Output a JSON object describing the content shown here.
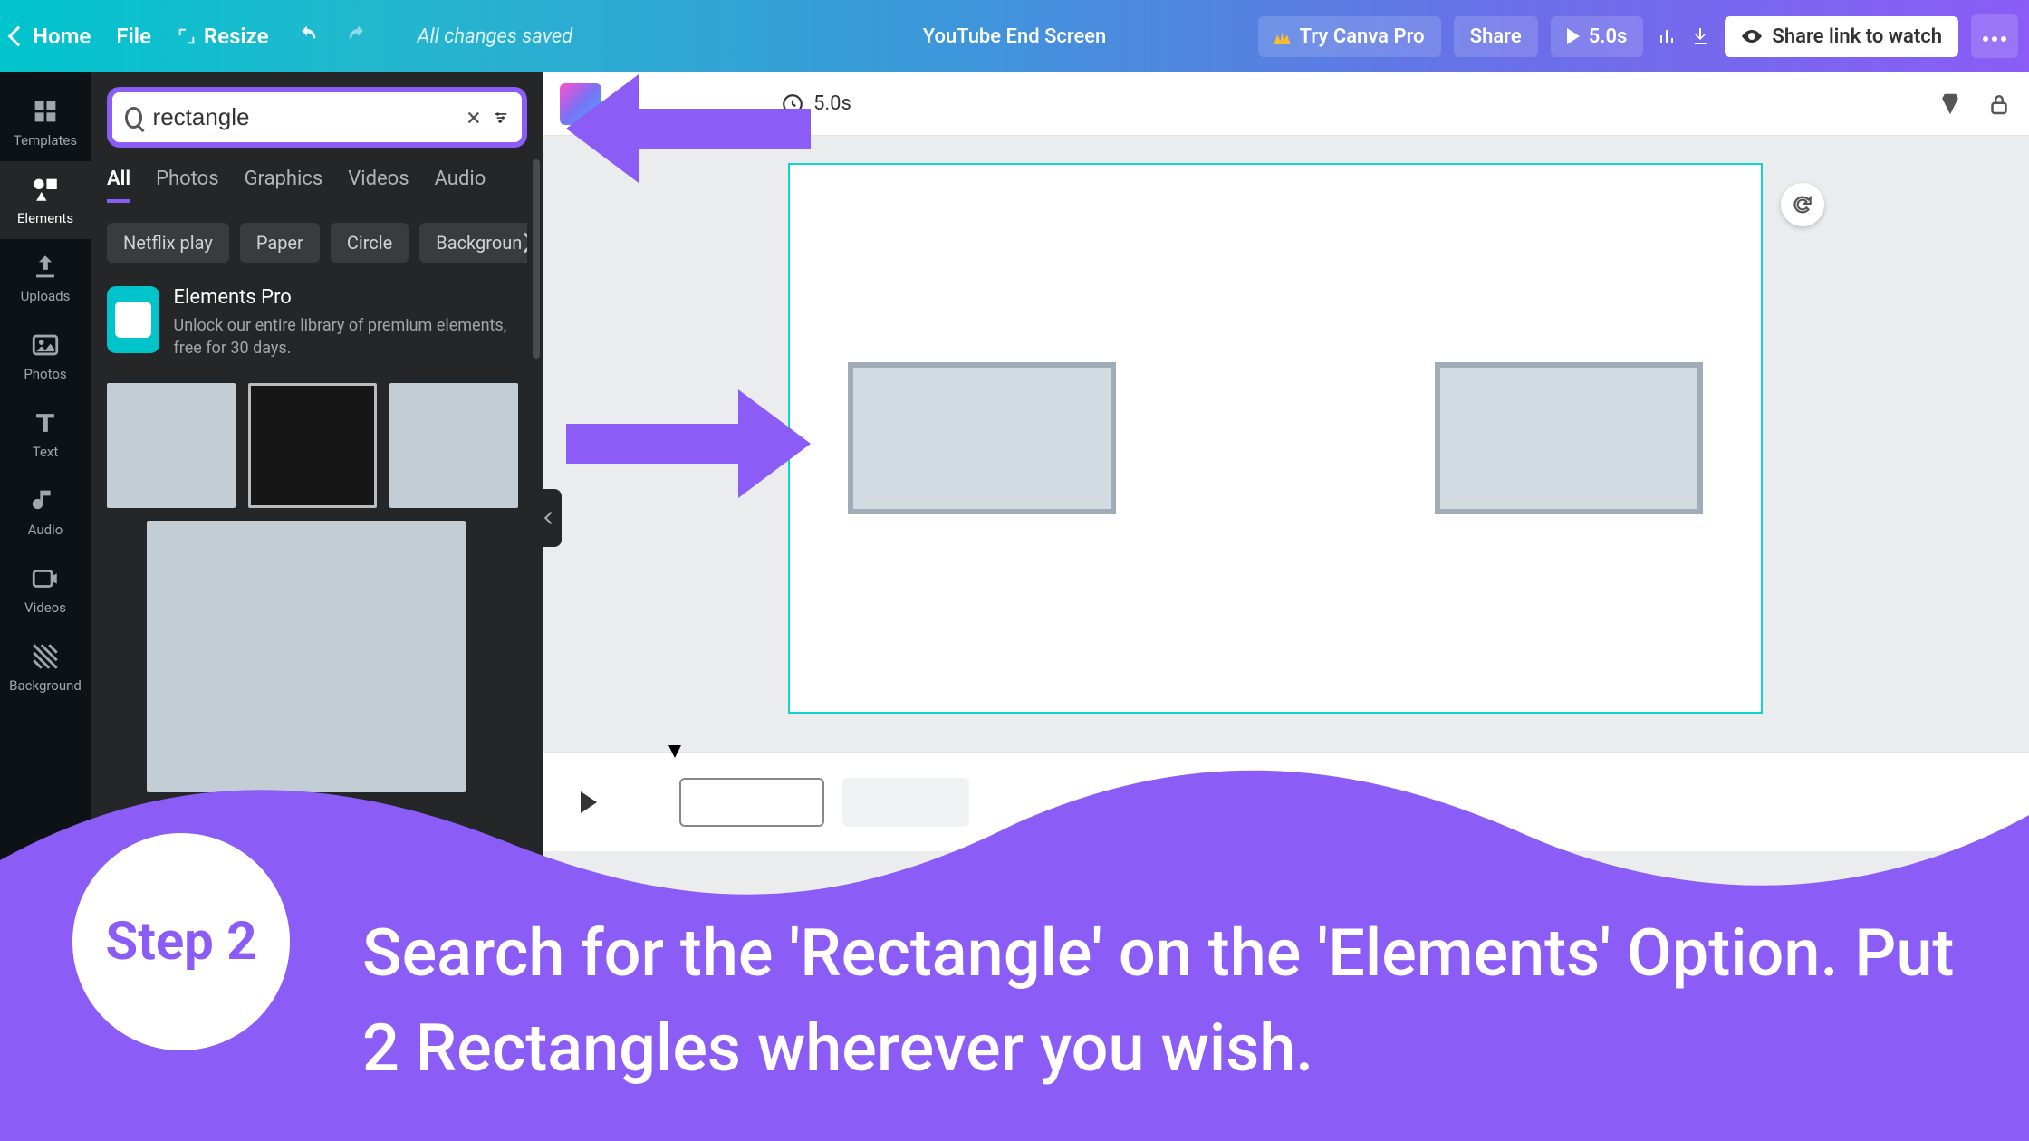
{
  "topbar": {
    "home": "Home",
    "file": "File",
    "resize": "Resize",
    "saved": "All changes saved",
    "doc_title": "YouTube End Screen",
    "try_pro": "Try Canva Pro",
    "share": "Share",
    "duration": "5.0s",
    "share_link": "Share link to watch"
  },
  "leftrail": {
    "templates": "Templates",
    "elements": "Elements",
    "uploads": "Uploads",
    "photos": "Photos",
    "text": "Text",
    "audio": "Audio",
    "videos": "Videos",
    "background": "Background"
  },
  "search": {
    "value": "rectangle"
  },
  "tabs": {
    "all": "All",
    "photos": "Photos",
    "graphics": "Graphics",
    "videos": "Videos",
    "audio": "Audio"
  },
  "chips": {
    "c1": "Netflix play",
    "c2": "Paper",
    "c3": "Circle",
    "c4": "Backgroun"
  },
  "pro": {
    "title": "Elements Pro",
    "sub": "Unlock our entire library of premium elements, free for 30 days."
  },
  "ctx": {
    "duration": "5.0s"
  },
  "overlay": {
    "step": "Step 2",
    "text": "Search for the 'Rectangle' on the 'Elements' Option. Put 2 Rectangles wherever you wish."
  }
}
